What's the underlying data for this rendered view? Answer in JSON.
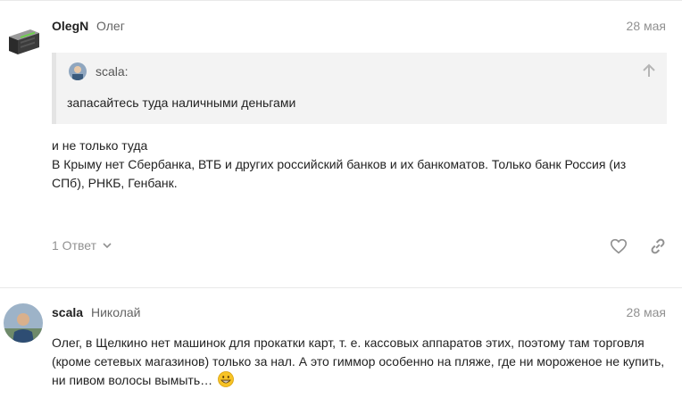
{
  "posts": [
    {
      "username": "OlegN",
      "fullname": "Олег",
      "date": "28 мая",
      "avatar_icon": "server-rack-icon",
      "quote": {
        "author": "scala:",
        "text": "запасайтесь туда наличными деньгами"
      },
      "body": [
        "и не только туда",
        "В Крыму нет Сбербанка, ВТБ и других российский банков и их банкоматов. Только банк Россия (из СПб), РНКБ, Генбанк."
      ],
      "replies_label": "1 Ответ"
    },
    {
      "username": "scala",
      "fullname": "Николай",
      "date": "28 мая",
      "avatar_icon": "user-photo-avatar",
      "body": [
        "Олег, в Щелкино нет машинок для прокатки карт, т. е. кассовых аппаратов этих, поэтому там торговля (кроме сетевых магазинов) только за нал. А это гиммор особенно на пляже, где ни мороженое не купить, ни пивом волосы вымыть…"
      ],
      "emoji": "grinning-face-emoji"
    }
  ],
  "colors": {
    "text": "#222222",
    "muted": "#919191",
    "quote_bg": "#f3f3f3",
    "divider": "#e9e9e9"
  }
}
